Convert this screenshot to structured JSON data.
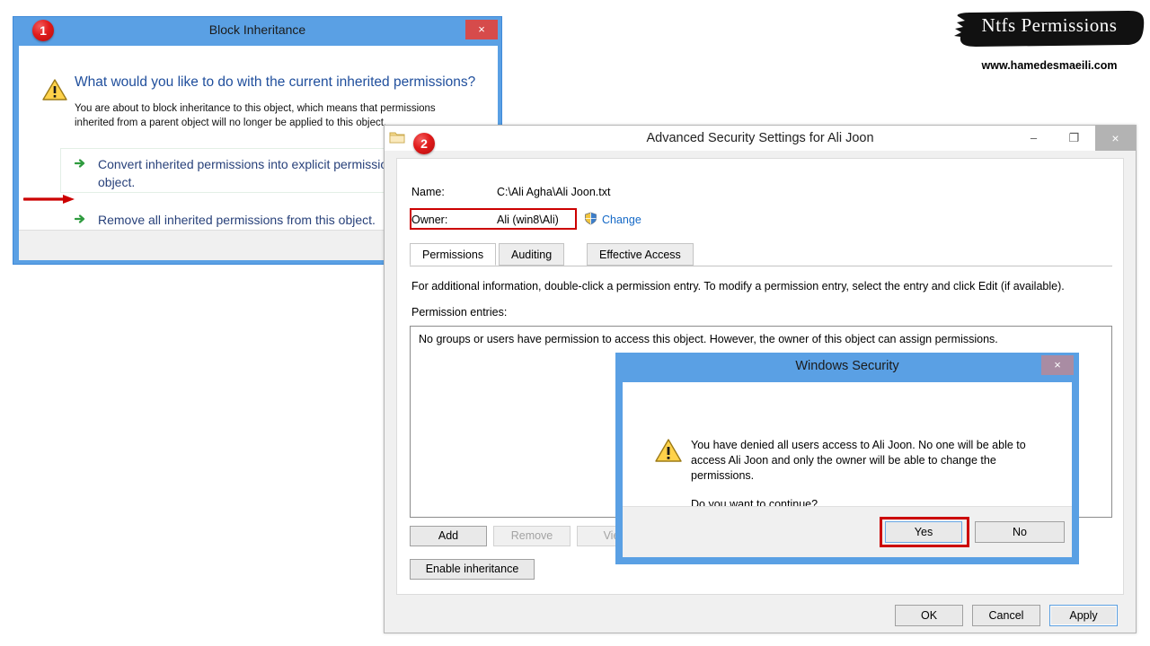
{
  "block_inheritance": {
    "badge": "1",
    "title": "Block Inheritance",
    "close_label": "×",
    "warning_icon": "warning-triangle-icon",
    "heading": "What would you like to do with the current inherited permissions?",
    "subtext": "You are about to block inheritance to this object, which means that permissions inherited from a parent object will no longer be applied to this object.",
    "options": [
      {
        "label": "Convert inherited permissions into explicit permissions on this object."
      },
      {
        "label": "Remove all inherited permissions from this object."
      }
    ]
  },
  "advanced_security": {
    "badge": "2",
    "title": "Advanced Security Settings for Ali Joon",
    "folder_icon": "folder-icon",
    "window_controls": {
      "minimize": "–",
      "maximize": "❐",
      "close": "×"
    },
    "name_label": "Name:",
    "name_value": "C:\\Ali Agha\\Ali Joon.txt",
    "owner_label": "Owner:",
    "owner_value": "Ali (win8\\Ali)",
    "change_link": "Change",
    "shield_icon": "shield-icon",
    "tabs": [
      {
        "label": "Permissions",
        "active": true
      },
      {
        "label": "Auditing",
        "active": false
      },
      {
        "label": "Effective Access",
        "active": false
      }
    ],
    "instructions": "For additional information, double-click a permission entry. To modify a permission entry, select the entry and click Edit (if available).",
    "entries_label": "Permission entries:",
    "entries_empty_message": "No groups or users have permission to access this object. However, the owner of this object can assign permissions.",
    "buttons": {
      "add": "Add",
      "remove": "Remove",
      "view": "View",
      "enable_inheritance": "Enable inheritance",
      "ok": "OK",
      "cancel": "Cancel",
      "apply": "Apply"
    }
  },
  "windows_security": {
    "title": "Windows Security",
    "close_label": "×",
    "warning_icon": "warning-triangle-icon",
    "message": "You have denied all users access to Ali Joon. No one will be able to access Ali Joon and only the owner will be able to change the permissions.",
    "question": "Do you want to continue?",
    "buttons": {
      "yes": "Yes",
      "no": "No"
    }
  },
  "watermark": {
    "title": "Ntfs Permissions",
    "url": "www.hamedesmaeili.com"
  },
  "colors": {
    "titlebar_blue": "#5aa0e4",
    "close_red": "#d64b4b",
    "accent_link": "#1569c7",
    "highlight_red": "#cc0000",
    "heading_blue": "#1f4e9c",
    "badge_red": "#e01b1b"
  }
}
